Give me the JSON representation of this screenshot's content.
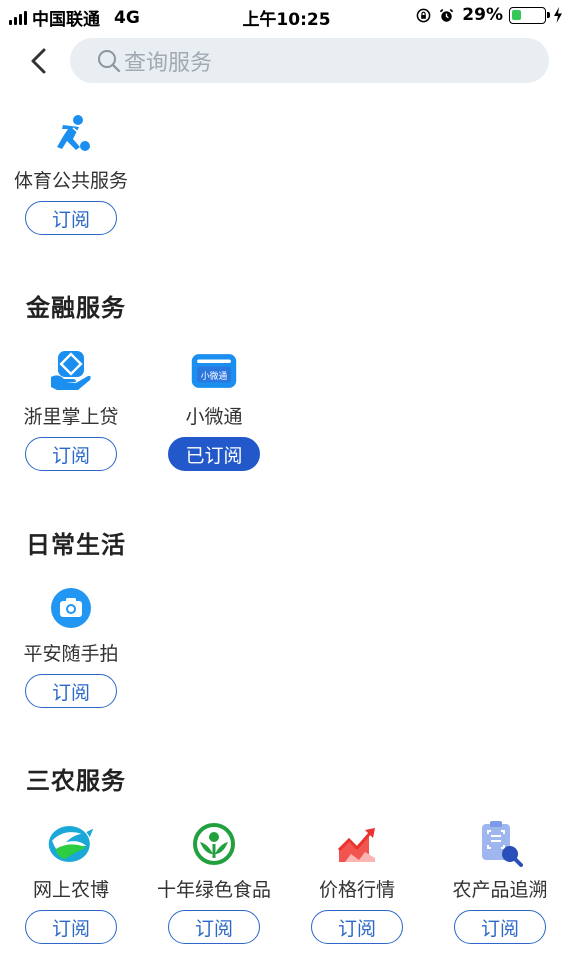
{
  "status_bar": {
    "carrier": "中国联通",
    "network": "4G",
    "time": "上午10:25",
    "battery_percent": "29%",
    "battery_level": 0.29
  },
  "search": {
    "placeholder": "查询服务"
  },
  "top_items": [
    {
      "name": "体育公共服务",
      "button": "订阅",
      "subscribed": false,
      "icon": "sport-person-icon"
    }
  ],
  "sections": [
    {
      "title": "金融服务",
      "items": [
        {
          "name": "浙里掌上贷",
          "button": "订阅",
          "subscribed": false,
          "icon": "loan-hand-icon"
        },
        {
          "name": "小微通",
          "button": "已订阅",
          "subscribed": true,
          "icon": "card-icon",
          "icon_text": "小微通"
        }
      ]
    },
    {
      "title": "日常生活",
      "items": [
        {
          "name": "平安随手拍",
          "button": "订阅",
          "subscribed": false,
          "icon": "camera-icon"
        }
      ]
    },
    {
      "title": "三农服务",
      "items": [
        {
          "name": "网上农博",
          "button": "订阅",
          "subscribed": false,
          "icon": "agri-expo-logo-icon"
        },
        {
          "name": "十年绿色食品",
          "button": "订阅",
          "subscribed": false,
          "icon": "green-food-logo-icon"
        },
        {
          "name": "价格行情",
          "button": "订阅",
          "subscribed": false,
          "icon": "price-trend-icon"
        },
        {
          "name": "农产品追溯",
          "button": "订阅",
          "subscribed": false,
          "icon": "trace-search-icon"
        }
      ]
    }
  ],
  "colors": {
    "accent": "#2b68c9",
    "subscribed_bg": "#2258c9",
    "search_bg": "#e9eef3"
  }
}
